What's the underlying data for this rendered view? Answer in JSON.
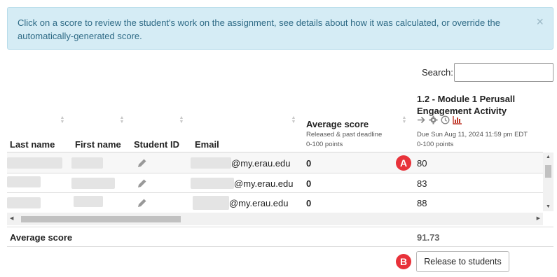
{
  "alert": {
    "message": "Click on a score to review the student's work on the assignment, see details about how it was calculated, or override the automatically-generated score.",
    "close_glyph": "×"
  },
  "search": {
    "label": "Search:",
    "value": ""
  },
  "columns": {
    "last_name": "Last name",
    "first_name": "First name",
    "student_id": "Student ID",
    "email": "Email",
    "average": {
      "title": "Average score",
      "sub1": "Released & past deadline",
      "sub2": "0-100 points"
    },
    "assignment": {
      "title_line1": "1.2 - Module 1 Perusall",
      "title_line2": "Engagement Activity",
      "due": "Due Sun Aug 11, 2024 11:59 pm EDT",
      "points": "0-100 points",
      "icons": [
        "arrow-right-icon",
        "gear-icon",
        "clock-icon",
        "bar-chart-icon"
      ]
    }
  },
  "rows": [
    {
      "email": "@my.erau.edu",
      "average": "0",
      "score": "80"
    },
    {
      "email": "@my.erau.edu",
      "average": "0",
      "score": "83"
    },
    {
      "email": "@my.erau.edu",
      "average": "0",
      "score": "88"
    }
  ],
  "footer": {
    "label": "Average score",
    "value": "91.73"
  },
  "release_button": "Release to students",
  "callouts": {
    "a": "A",
    "b": "B"
  },
  "colors": {
    "alert_bg": "#d5ecf5",
    "alert_text": "#2f6b86",
    "callout": "#e8323a",
    "chart_icon": "#c0392b"
  }
}
